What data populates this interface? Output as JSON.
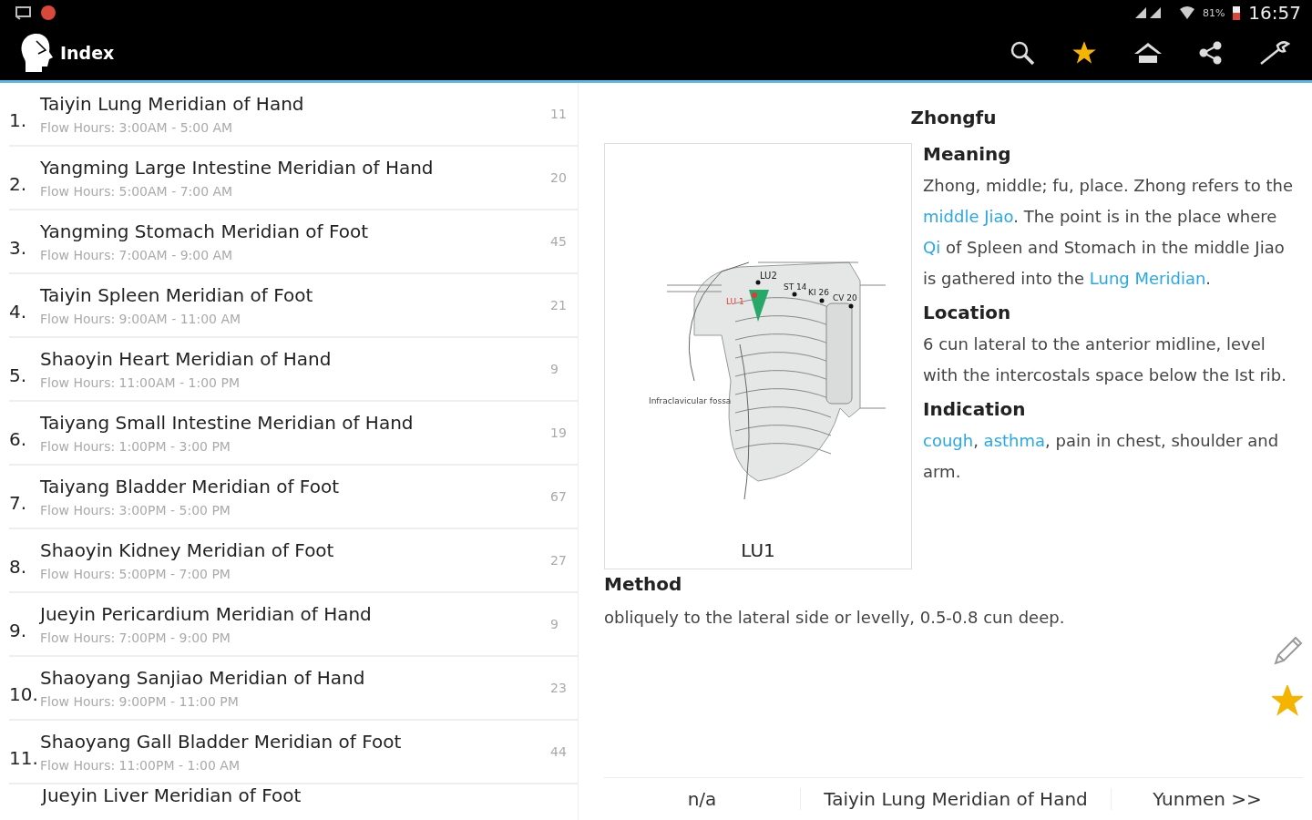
{
  "status_bar": {
    "battery": "81%",
    "time": "16:57"
  },
  "app_bar": {
    "title": "Index",
    "actions": [
      {
        "kind": "search",
        "highlighted": false
      },
      {
        "kind": "star",
        "highlighted": true
      },
      {
        "kind": "home",
        "highlighted": false
      },
      {
        "kind": "share",
        "highlighted": false
      },
      {
        "kind": "tools",
        "highlighted": false
      }
    ]
  },
  "meridians": [
    {
      "number": "1.",
      "name": "Taiyin Lung Meridian of Hand",
      "hours": "Flow Hours: 3:00AM - 5:00 AM",
      "count": "11"
    },
    {
      "number": "2.",
      "name": "Yangming Large Intestine Meridian of Hand",
      "hours": "Flow Hours: 5:00AM - 7:00 AM",
      "count": "20"
    },
    {
      "number": "3.",
      "name": "Yangming Stomach Meridian of Foot",
      "hours": "Flow Hours: 7:00AM - 9:00 AM",
      "count": "45"
    },
    {
      "number": "4.",
      "name": "Taiyin Spleen Meridian of Foot",
      "hours": "Flow Hours: 9:00AM - 11:00 AM",
      "count": "21"
    },
    {
      "number": "5.",
      "name": "Shaoyin Heart Meridian of Hand",
      "hours": "Flow Hours: 11:00AM - 1:00 PM",
      "count": "9"
    },
    {
      "number": "6.",
      "name": "Taiyang Small Intestine Meridian of Hand",
      "hours": "Flow Hours: 1:00PM - 3:00 PM",
      "count": "19"
    },
    {
      "number": "7.",
      "name": "Taiyang Bladder Meridian of Foot",
      "hours": "Flow Hours: 3:00PM - 5:00 PM",
      "count": "67"
    },
    {
      "number": "8.",
      "name": "Shaoyin Kidney Meridian of Foot",
      "hours": "Flow Hours: 5:00PM - 7:00 PM",
      "count": "27"
    },
    {
      "number": "9.",
      "name": "Jueyin Pericardium Meridian of Hand",
      "hours": "Flow Hours: 7:00PM - 9:00 PM",
      "count": "9"
    },
    {
      "number": "10.",
      "name": "Shaoyang Sanjiao Meridian of Hand",
      "hours": "Flow Hours: 9:00PM - 11:00 PM",
      "count": "23"
    },
    {
      "number": "11.",
      "name": "Shaoyang Gall Bladder Meridian of Foot",
      "hours": "Flow Hours: 11:00PM - 1:00 AM",
      "count": "44"
    },
    {
      "name": "Jueyin Liver Meridian of Foot"
    }
  ],
  "point": {
    "title": "Zhongfu",
    "figure": {
      "caption": "LU1",
      "labels": {
        "point": "LU 1",
        "lu2": "LU2",
        "st14": "ST 14",
        "ki26": "KI 26",
        "cv20": "CV 20",
        "fossa": "Infraclavicular fossa"
      }
    },
    "sections": [
      {
        "heading": "Meaning",
        "text": [
          {
            "t": "Zhong, middle; fu, place. Zhong refers to the ",
            "link": false
          },
          {
            "t": "middle Jiao",
            "link": true
          },
          {
            "t": ". The point is in the place where ",
            "link": false
          },
          {
            "t": "Qi",
            "link": true
          },
          {
            "t": " of Spleen and Stomach in the middle Jiao is gathered into the ",
            "link": false
          },
          {
            "t": "Lung Meridian",
            "link": true
          },
          {
            "t": ".",
            "link": false
          }
        ]
      },
      {
        "heading": "Location",
        "text": [
          {
            "t": "6 cun lateral to the anterior midline, level with the intercostals space below the Ist rib.",
            "link": false
          }
        ]
      },
      {
        "heading": "Indication",
        "text": [
          {
            "t": "cough",
            "link": true
          },
          {
            "t": ", ",
            "link": false
          },
          {
            "t": "asthma",
            "link": true
          },
          {
            "t": ", pain in chest, shoulder and arm.",
            "link": false
          }
        ]
      }
    ],
    "method": {
      "heading": "Method",
      "text": "obliquely to the lateral side or levelly, 0.5-0.8 cun deep."
    },
    "favorite": true
  },
  "footer": {
    "previous": "n/a",
    "meridian": "Taiyin Lung Meridian of Hand",
    "next": "Yunmen >>"
  }
}
